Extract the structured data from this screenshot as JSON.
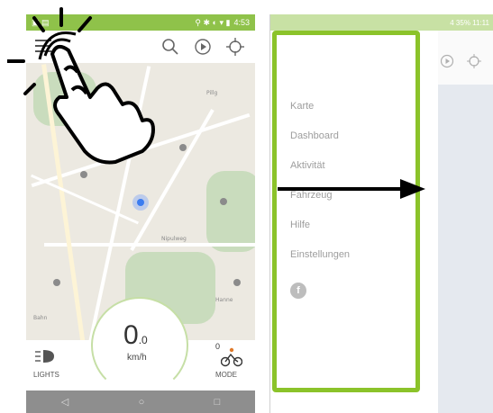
{
  "left_screen": {
    "status_time": "4:53",
    "speed": {
      "value": "0",
      "decimal": ".0",
      "unit": "km/h"
    },
    "lights_label": "LIGHTS",
    "mode_label": "MODE",
    "mode_value": "0",
    "map_labels": {
      "nipulweg": "Nipulweg",
      "pillg": "Pillg",
      "hanne": "Hanne",
      "bahn": "Bahn"
    }
  },
  "right_screen": {
    "drawer_items": [
      "Karte",
      "Dashboard",
      "Aktivität",
      "Fahrzeug",
      "Hilfe",
      "Einstellungen"
    ],
    "facebook_glyph": "f",
    "status_right": "4 35% 11:11"
  },
  "colors": {
    "accent_green": "#8bc32a",
    "status_green": "#8fc24a",
    "nav_gray": "#8e8e8e"
  },
  "icons": {
    "search": "search-icon",
    "play": "play-circle-icon",
    "locate": "crosshair-icon",
    "facebook": "facebook-icon",
    "bike": "bike-icon",
    "headlight": "headlight-icon"
  }
}
